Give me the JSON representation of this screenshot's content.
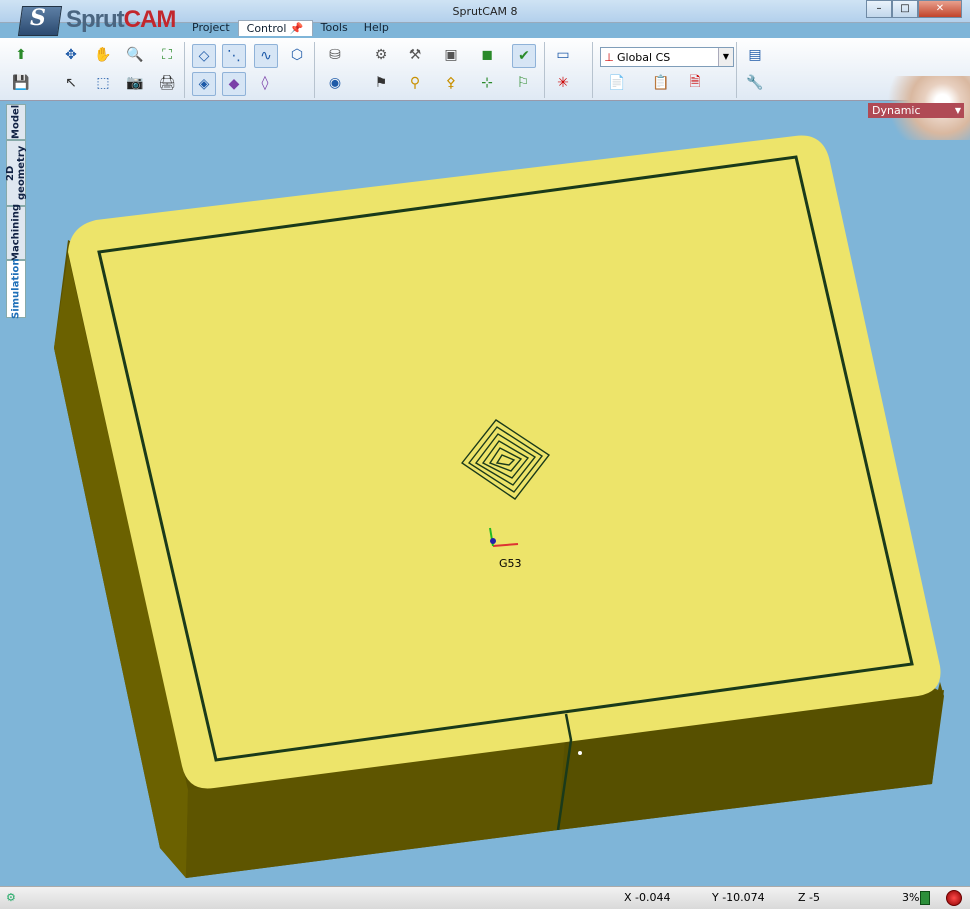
{
  "window": {
    "title": "SprutCAM 8",
    "logo_text_1": "Sprut",
    "logo_text_2": "CAM"
  },
  "menu": [
    "Project",
    "Control",
    "Tools",
    "Help"
  ],
  "window_buttons": [
    "–",
    "□",
    "✕"
  ],
  "toolbar": {
    "coordinate_system": "Global CS",
    "view_mode": "Dynamic"
  },
  "side_tabs": [
    "Model",
    "2D geometry",
    "Machining",
    "Simulation"
  ],
  "viewport": {
    "cs_label": "G53"
  },
  "status": {
    "x": "X -0.044",
    "y": "Y -10.074",
    "z": "Z -5",
    "progress": "3%"
  },
  "colors": {
    "background": "#7fb5d8",
    "stock_top": "#ede46a",
    "stock_side": "#5b5200",
    "toolpath": "#1a3a1a"
  }
}
